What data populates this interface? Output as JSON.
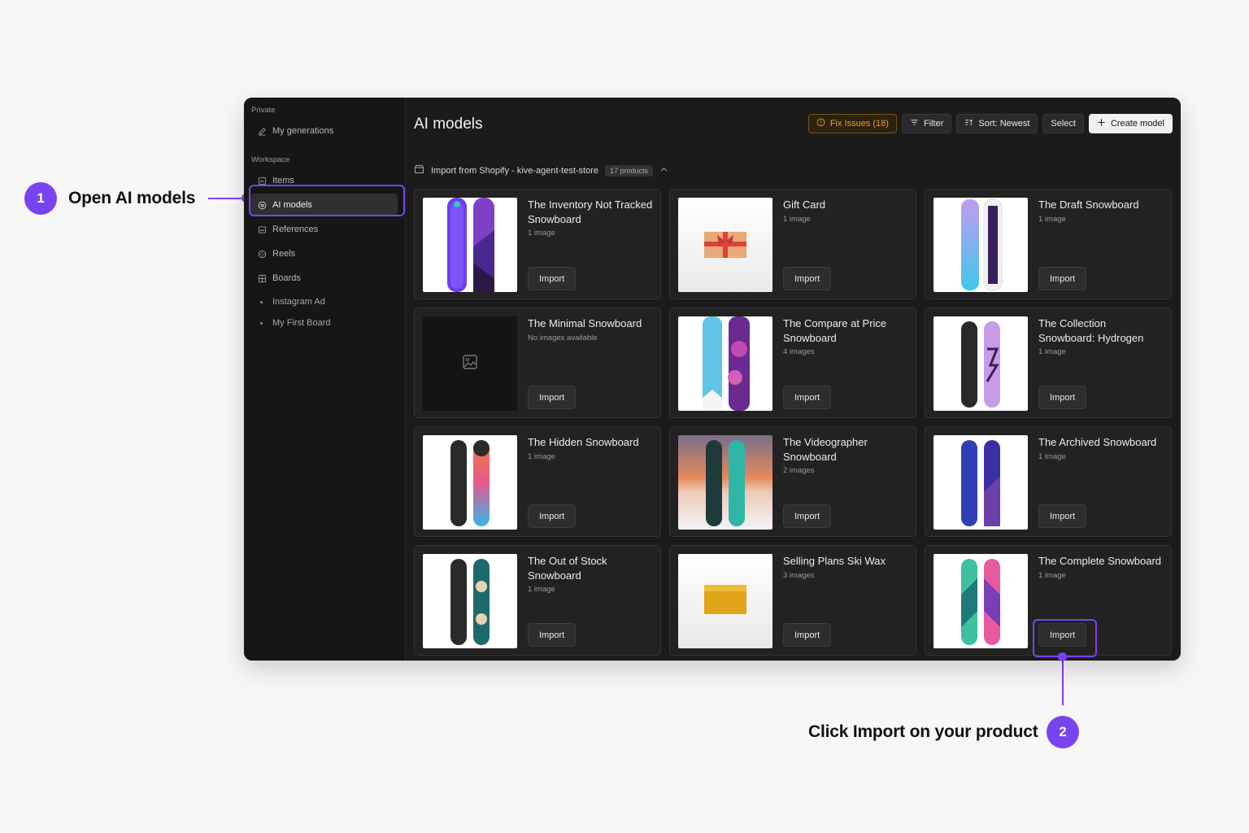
{
  "annotations": {
    "step1": {
      "number": "1",
      "text": "Open AI models"
    },
    "step2": {
      "number": "2",
      "text": "Click Import on your product"
    }
  },
  "sidebar": {
    "private_label": "Private",
    "my_generations": "My generations",
    "workspace_label": "Workspace",
    "items": [
      {
        "label": "Items",
        "icon": "items-icon"
      },
      {
        "label": "AI models",
        "icon": "ai-models-icon",
        "active": true
      },
      {
        "label": "References",
        "icon": "references-icon"
      },
      {
        "label": "Reels",
        "icon": "reels-icon"
      },
      {
        "label": "Boards",
        "icon": "boards-icon"
      }
    ],
    "boards": [
      "Instagram Ad",
      "My First Board"
    ]
  },
  "header": {
    "title": "AI models",
    "fix_issues": "Fix Issues (18)",
    "filter": "Filter",
    "sort": "Sort: Newest",
    "select": "Select",
    "create_model": "Create model"
  },
  "import_section": {
    "label": "Import from Shopify - kive-agent-test-store",
    "count": "17 products"
  },
  "products": [
    {
      "title": "The Inventory Not Tracked Snowboard",
      "sub": "1 image",
      "import": "Import"
    },
    {
      "title": "Gift Card",
      "sub": "1 image",
      "import": "Import"
    },
    {
      "title": "The Draft Snowboard",
      "sub": "1 image",
      "import": "Import"
    },
    {
      "title": "The Minimal Snowboard",
      "sub": "No images available",
      "import": "Import"
    },
    {
      "title": "The Compare at Price Snowboard",
      "sub": "4 images",
      "import": "Import"
    },
    {
      "title": "The Collection Snowboard: Hydrogen",
      "sub": "1 image",
      "import": "Import"
    },
    {
      "title": "The Hidden Snowboard",
      "sub": "1 image",
      "import": "Import"
    },
    {
      "title": "The Videographer Snowboard",
      "sub": "2 images",
      "import": "Import"
    },
    {
      "title": "The Archived Snowboard",
      "sub": "1 image",
      "import": "Import"
    },
    {
      "title": "The Out of Stock Snowboard",
      "sub": "1 image",
      "import": "Import"
    },
    {
      "title": "Selling Plans Ski Wax",
      "sub": "3 images",
      "import": "Import"
    },
    {
      "title": "The Complete Snowboard",
      "sub": "1 image",
      "import": "Import"
    }
  ],
  "colors": {
    "accent": "#7a43f0",
    "warning": "#f29a2e",
    "window_bg": "#1d1d1d"
  }
}
